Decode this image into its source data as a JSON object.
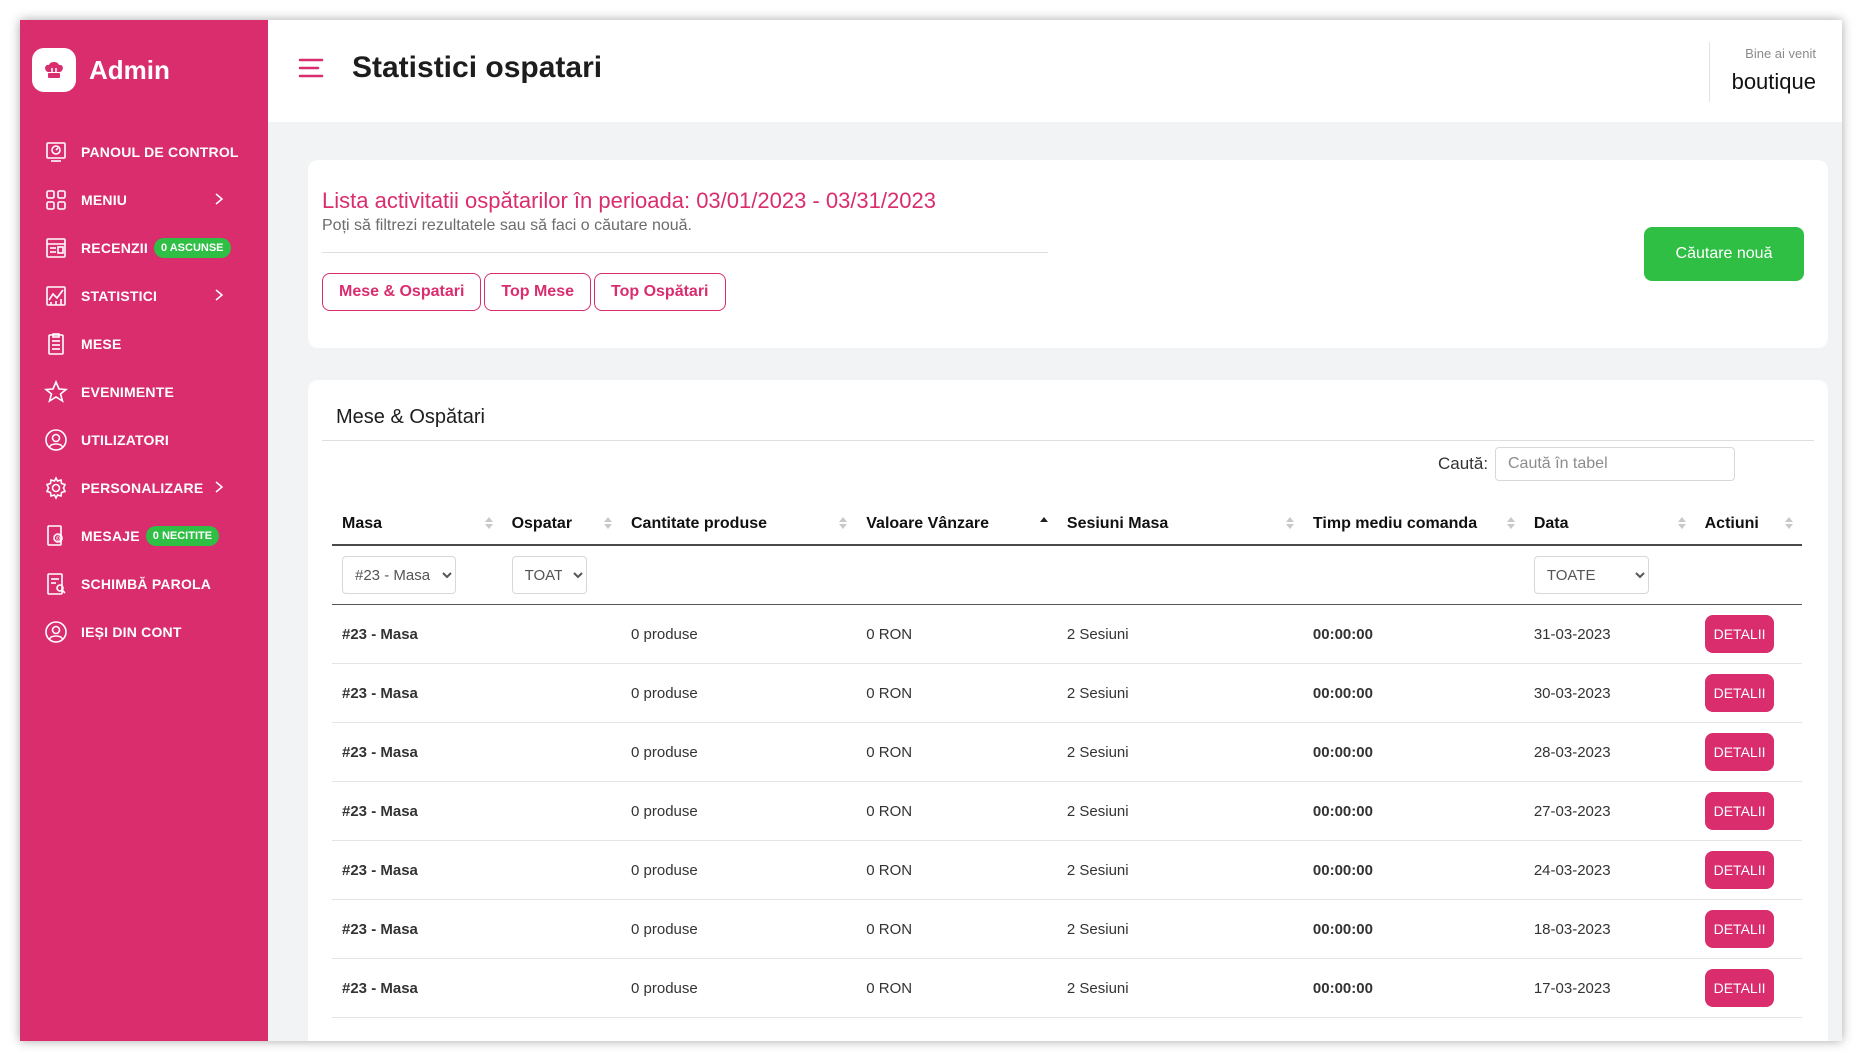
{
  "brand": {
    "name": "Admin",
    "logo_icon": "chef-hat-icon"
  },
  "colors": {
    "accent": "#d92d6e",
    "success": "#2fbf45",
    "background": "#f2f3f5"
  },
  "sidebar": {
    "items": [
      {
        "label": "PANOUL DE CONTROL",
        "icon": "dashboard-icon"
      },
      {
        "label": "MENIU",
        "icon": "grid-icon",
        "has_submenu": true
      },
      {
        "label": "RECENZII",
        "icon": "reviews-icon",
        "badge": "0 ASCUNSE"
      },
      {
        "label": "STATISTICI",
        "icon": "chart-icon",
        "has_submenu": true
      },
      {
        "label": "MESE",
        "icon": "clipboard-icon"
      },
      {
        "label": "EVENIMENTE",
        "icon": "star-icon"
      },
      {
        "label": "UTILIZATORI",
        "icon": "user-icon"
      },
      {
        "label": "PERSONALIZARE",
        "icon": "gear-icon",
        "has_submenu": true
      },
      {
        "label": "MESAJE",
        "icon": "message-icon",
        "badge": "0 NECITITE"
      },
      {
        "label": "SCHIMBĂ PAROLA",
        "icon": "password-icon"
      },
      {
        "label": "IEȘI DIN CONT",
        "icon": "logout-user-icon"
      }
    ]
  },
  "header": {
    "title": "Statistici ospatari",
    "welcome": "Bine ai venit",
    "username": "boutique"
  },
  "period_card": {
    "title": "Lista activitatii ospătarilor în perioada: 03/01/2023 - 03/31/2023",
    "subtitle": "Poți să filtrezi rezultatele sau să faci o căutare nouă.",
    "tabs": [
      "Mese & Ospatari",
      "Top Mese",
      "Top Ospătari"
    ],
    "new_search_button": "Căutare nouă"
  },
  "table_card": {
    "title": "Mese & Ospătari",
    "search_label": "Caută:",
    "search_placeholder": "Caută în tabel",
    "columns": [
      "Masa",
      "Ospatar",
      "Cantitate produse",
      "Valoare Vânzare",
      "Sesiuni Masa",
      "Timp mediu comanda",
      "Data",
      "Actiuni"
    ],
    "sorted_column": "Valoare Vânzare",
    "filters": {
      "masa": "#23 - Masa",
      "ospatar": "TOATE",
      "data": "TOATE"
    },
    "rows": [
      {
        "masa": "#23 - Masa",
        "ospatar": "",
        "cantitate": "0 produse",
        "valoare": "0 RON",
        "sesiuni": "2 Sesiuni",
        "timp": "00:00:00",
        "data": "31-03-2023",
        "action": "DETALII"
      },
      {
        "masa": "#23 - Masa",
        "ospatar": "",
        "cantitate": "0 produse",
        "valoare": "0 RON",
        "sesiuni": "2 Sesiuni",
        "timp": "00:00:00",
        "data": "30-03-2023",
        "action": "DETALII"
      },
      {
        "masa": "#23 - Masa",
        "ospatar": "",
        "cantitate": "0 produse",
        "valoare": "0 RON",
        "sesiuni": "2 Sesiuni",
        "timp": "00:00:00",
        "data": "28-03-2023",
        "action": "DETALII"
      },
      {
        "masa": "#23 - Masa",
        "ospatar": "",
        "cantitate": "0 produse",
        "valoare": "0 RON",
        "sesiuni": "2 Sesiuni",
        "timp": "00:00:00",
        "data": "27-03-2023",
        "action": "DETALII"
      },
      {
        "masa": "#23 - Masa",
        "ospatar": "",
        "cantitate": "0 produse",
        "valoare": "0 RON",
        "sesiuni": "2 Sesiuni",
        "timp": "00:00:00",
        "data": "24-03-2023",
        "action": "DETALII"
      },
      {
        "masa": "#23 - Masa",
        "ospatar": "",
        "cantitate": "0 produse",
        "valoare": "0 RON",
        "sesiuni": "2 Sesiuni",
        "timp": "00:00:00",
        "data": "18-03-2023",
        "action": "DETALII"
      },
      {
        "masa": "#23 - Masa",
        "ospatar": "",
        "cantitate": "0 produse",
        "valoare": "0 RON",
        "sesiuni": "2 Sesiuni",
        "timp": "00:00:00",
        "data": "17-03-2023",
        "action": "DETALII"
      }
    ]
  }
}
